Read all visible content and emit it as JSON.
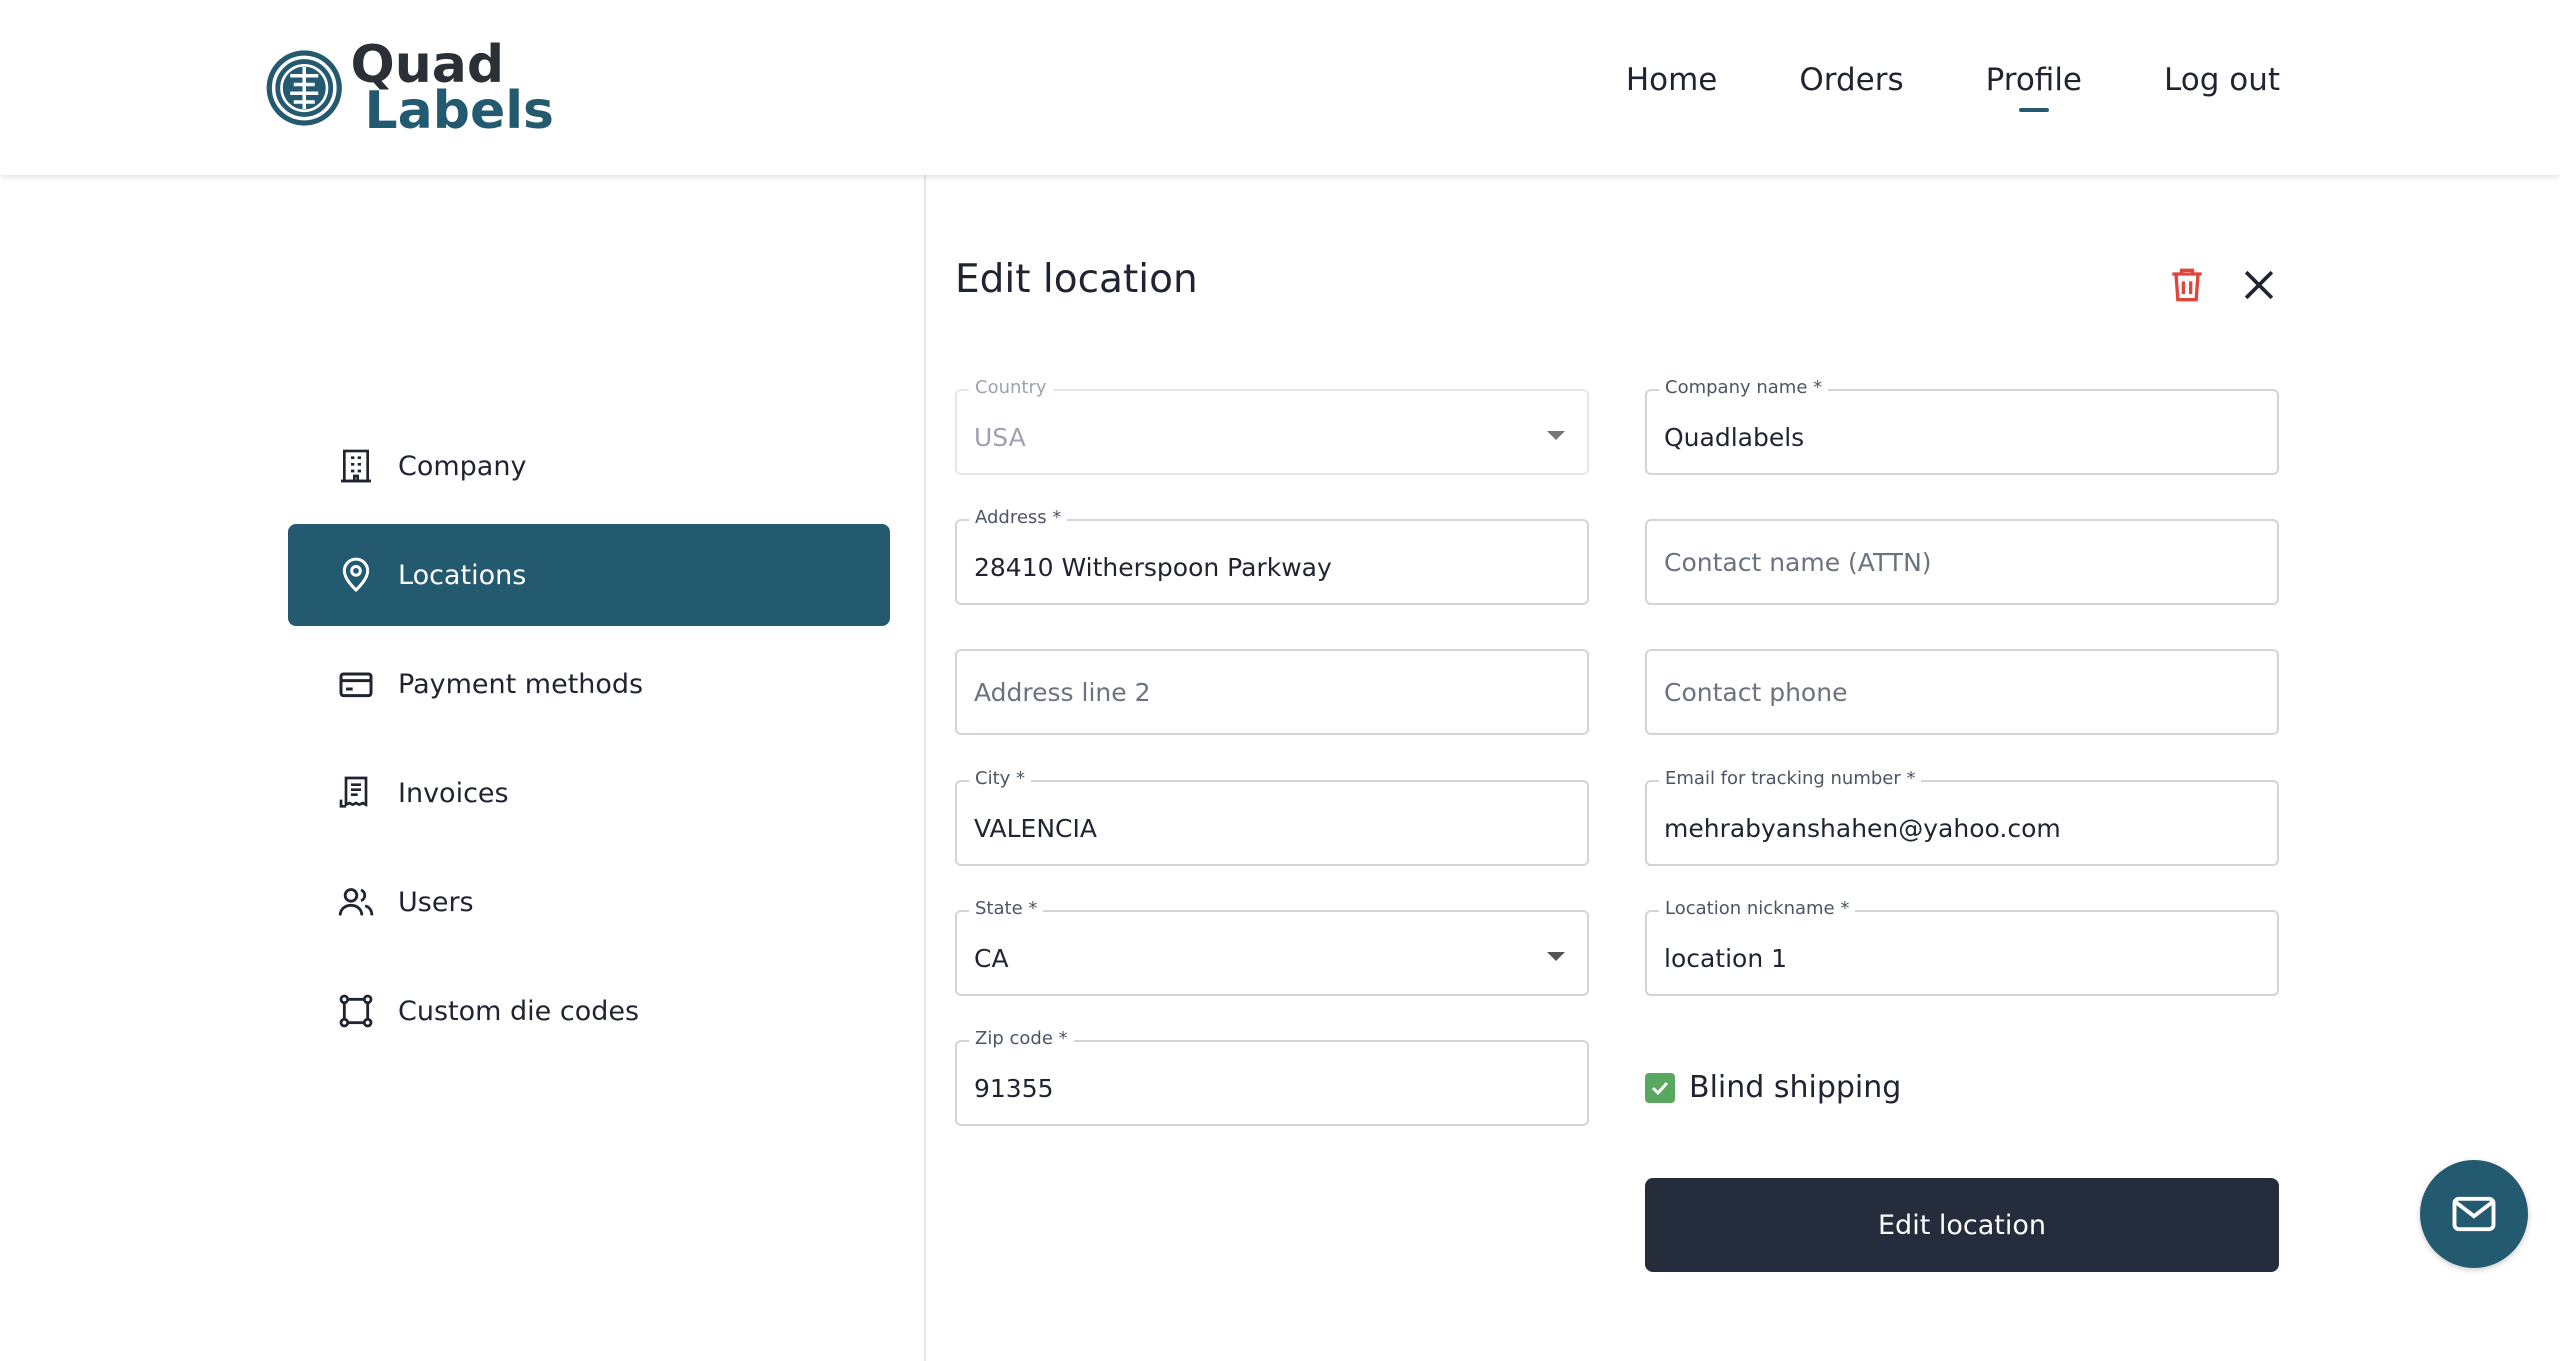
{
  "brand": {
    "line1": "Quad",
    "line2": "Labels",
    "primary_color": "#245a6f",
    "dark_color": "#252d3c"
  },
  "nav": {
    "items": [
      "Home",
      "Orders",
      "Profile",
      "Log out"
    ],
    "active": "Profile"
  },
  "sidebar": {
    "items": [
      {
        "label": "Company",
        "icon": "building-icon"
      },
      {
        "label": "Locations",
        "icon": "map-pin-icon",
        "active": true
      },
      {
        "label": "Payment methods",
        "icon": "credit-card-icon"
      },
      {
        "label": "Invoices",
        "icon": "receipt-icon"
      },
      {
        "label": "Users",
        "icon": "users-icon"
      },
      {
        "label": "Custom die codes",
        "icon": "die-shape-icon"
      }
    ]
  },
  "form": {
    "title": "Edit location",
    "country": {
      "label": "Country",
      "value": "USA"
    },
    "company_name": {
      "label": "Company name *",
      "value": "Quadlabels"
    },
    "address": {
      "label": "Address *",
      "value": "28410 Witherspoon Parkway"
    },
    "contact_name": {
      "placeholder": "Contact name (ATTN)"
    },
    "address2": {
      "placeholder": "Address line 2"
    },
    "contact_phone": {
      "placeholder": "Contact phone"
    },
    "city": {
      "label": "City *",
      "value": "VALENCIA"
    },
    "email": {
      "label": "Email for tracking number *",
      "value": "mehrabyanshahen@yahoo.com"
    },
    "state": {
      "label": "State *",
      "value": "CA"
    },
    "nickname": {
      "label": "Location nickname *",
      "value": "location 1"
    },
    "zip": {
      "label": "Zip code *",
      "value": "91355"
    },
    "blind_shipping": {
      "label": "Blind shipping",
      "checked": true,
      "color": "#59a85f"
    },
    "submit_label": "Edit location",
    "delete_icon_color": "#e0453a"
  }
}
